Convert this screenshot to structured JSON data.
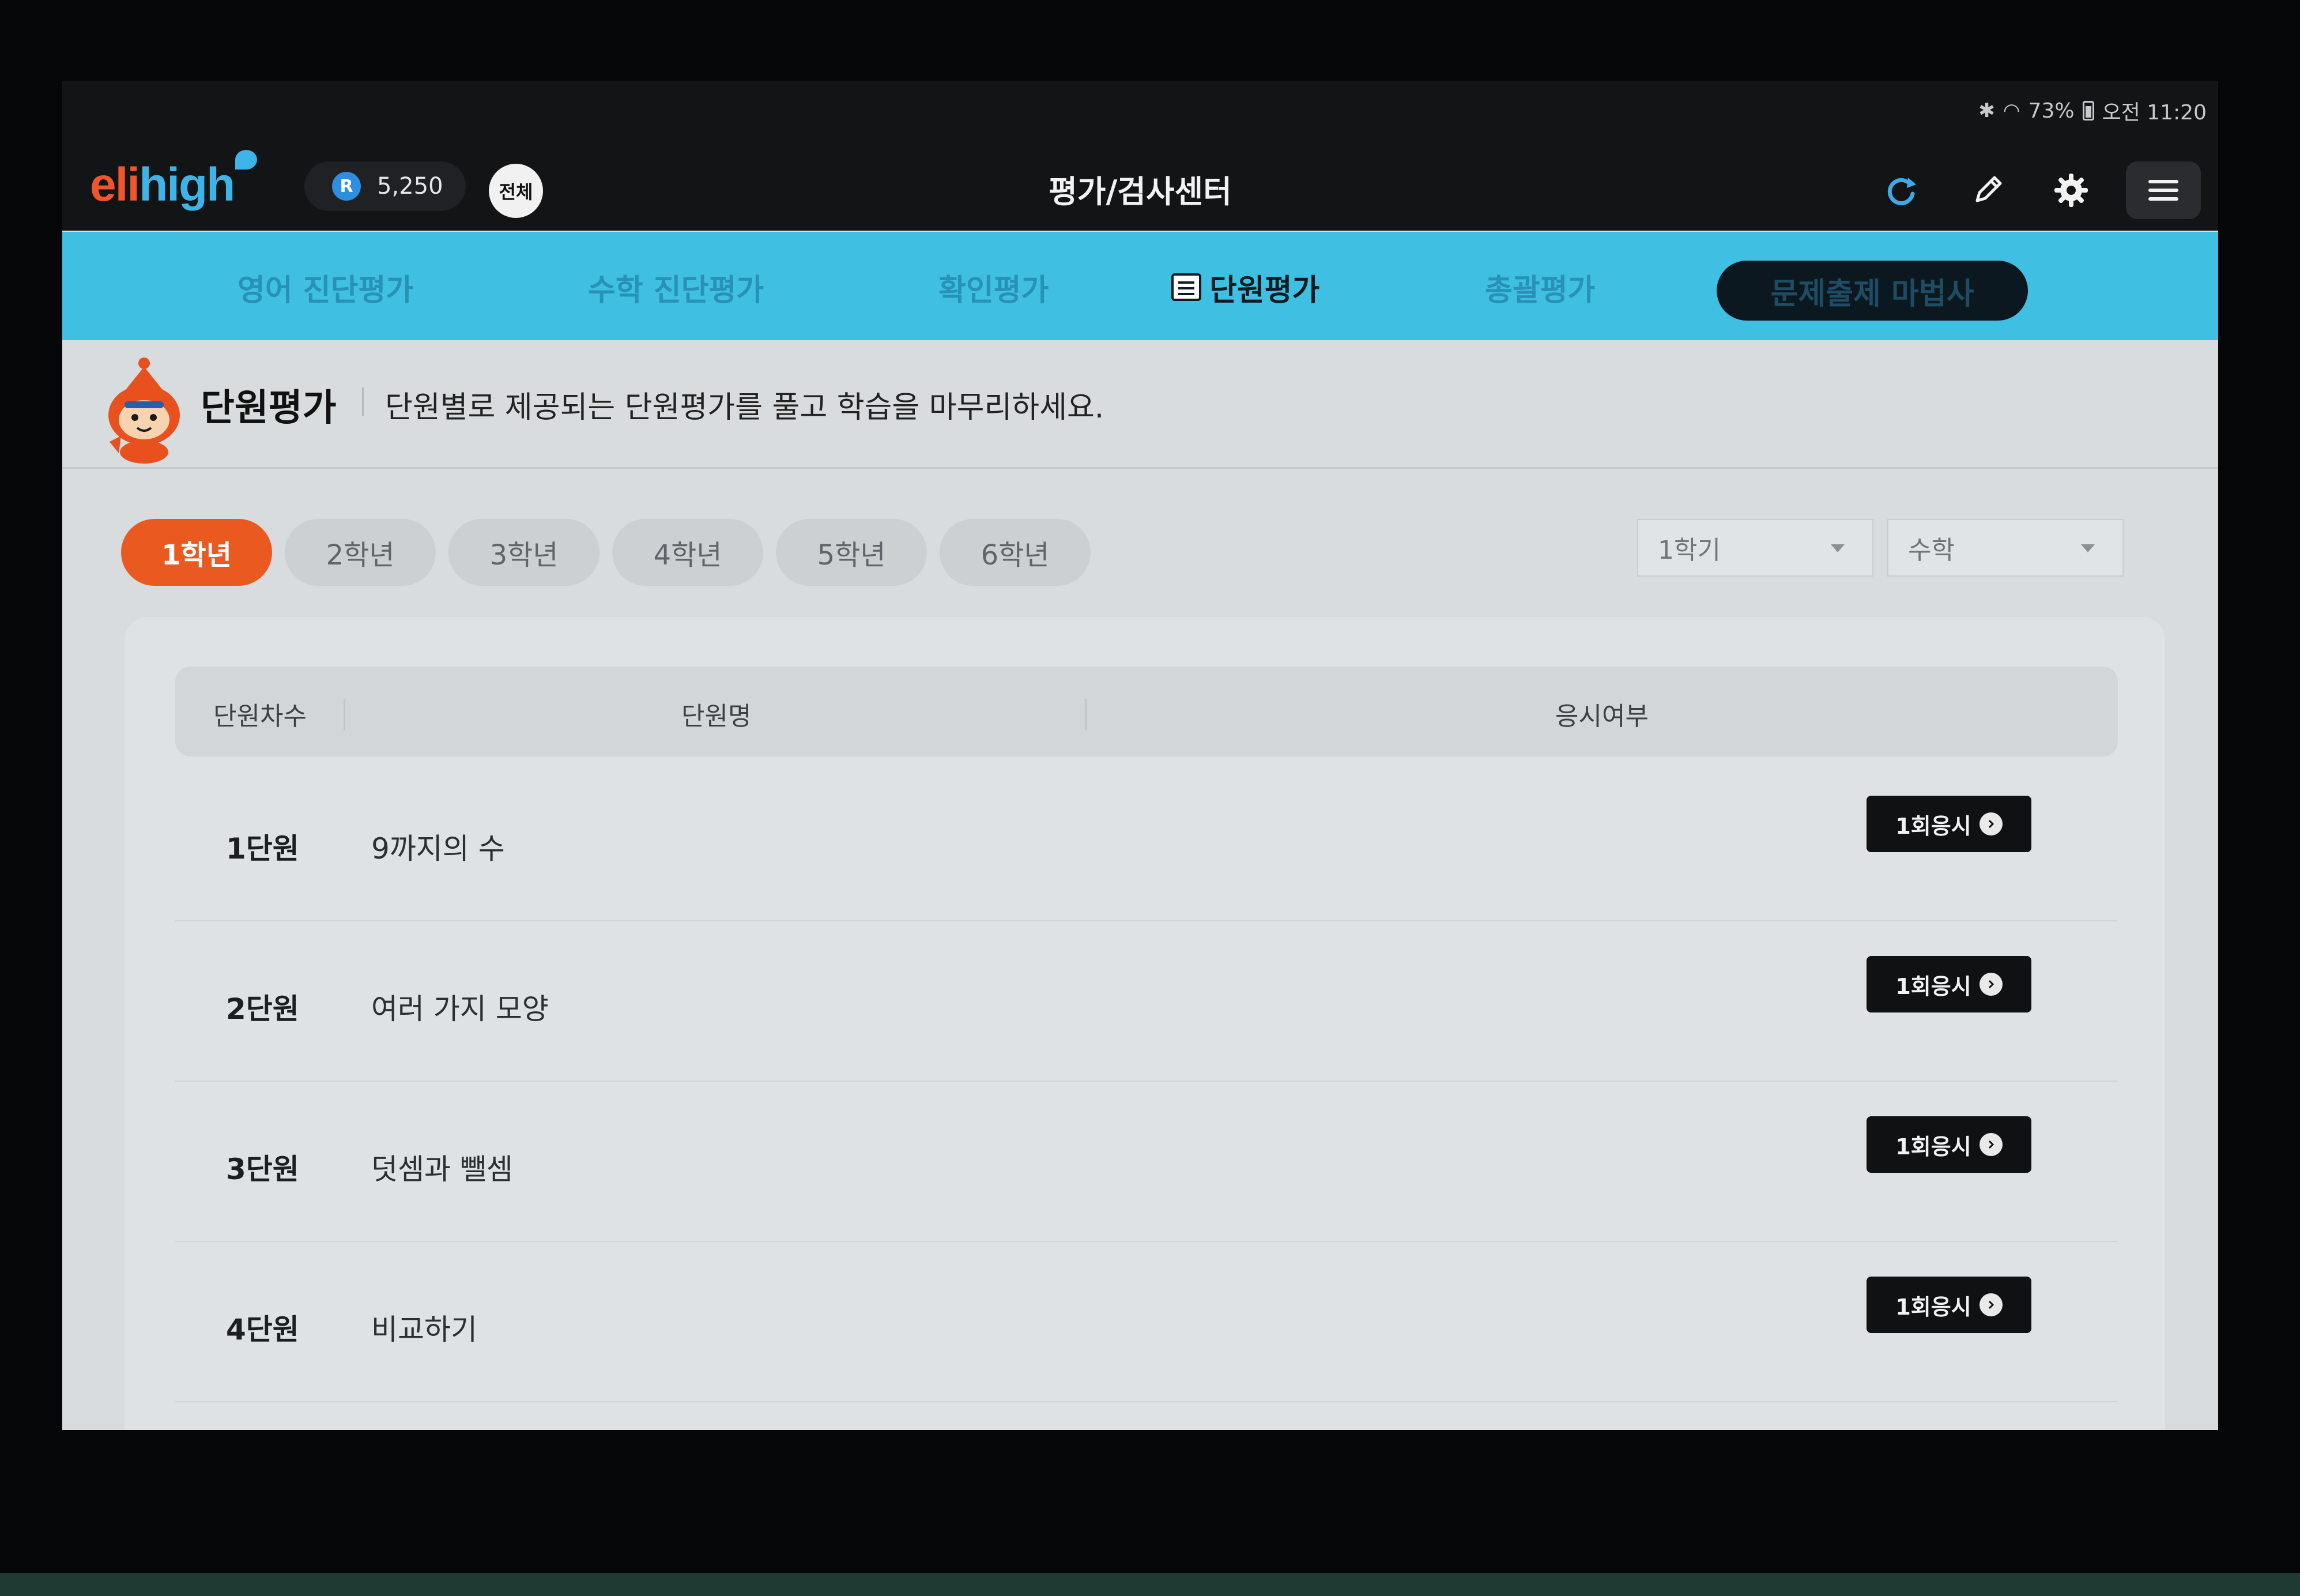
{
  "status": {
    "battery": "73%",
    "time": "오전 11:20",
    "bluetooth_icon": "bluetooth-icon",
    "wifi_icon": "wifi-icon"
  },
  "header": {
    "logo_part1": "eli",
    "logo_part2": "high",
    "points": "5,250",
    "points_badge": "R",
    "all_label": "전체",
    "title": "평가/검사센터",
    "icons": [
      "sync-icon",
      "pencil-icon",
      "gear-icon",
      "menu-icon"
    ]
  },
  "tabs": [
    {
      "label": "영어 진단평가",
      "active": false
    },
    {
      "label": "수학 진단평가",
      "active": false
    },
    {
      "label": "확인평가",
      "active": false
    },
    {
      "label": "단원평가",
      "active": true
    },
    {
      "label": "총괄평가",
      "active": false
    }
  ],
  "wizard_label": "문제출제 마법사",
  "section": {
    "title": "단원평가",
    "description": "단원별로 제공되는 단원평가를 풀고 학습을 마무리하세요."
  },
  "grades": [
    "1학년",
    "2학년",
    "3학년",
    "4학년",
    "5학년",
    "6학년"
  ],
  "filters": {
    "semester": "1학기",
    "subject": "수학"
  },
  "table": {
    "columns": [
      "단원차수",
      "단원명",
      "응시여부"
    ],
    "rows": [
      {
        "unit": "1단원",
        "name": "9까지의 수",
        "action": "1회응시"
      },
      {
        "unit": "2단원",
        "name": "여러 가지 모양",
        "action": "1회응시"
      },
      {
        "unit": "3단원",
        "name": "덧셈과 뺄셈",
        "action": "1회응시"
      },
      {
        "unit": "4단원",
        "name": "비교하기",
        "action": "1회응시"
      }
    ]
  },
  "colors": {
    "accent_orange": "#ea5a20",
    "tab_blue": "#3fbfe2",
    "header_dark": "#131416",
    "logo_blue": "#3db4e8"
  }
}
